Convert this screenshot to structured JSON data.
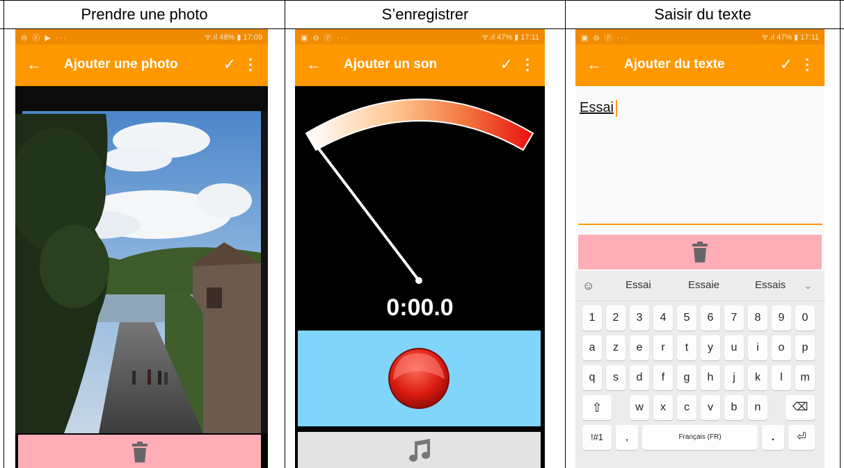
{
  "columns": [
    {
      "title": "Prendre une photo"
    },
    {
      "title": "S’enregistrer"
    },
    {
      "title": "Saisir du texte"
    }
  ],
  "panels": {
    "photo": {
      "status_left": "⊖ ⓟ ▶ ···",
      "status_right": "ᯤ.ıl 48% ▮ 17:09",
      "title": "Ajouter une photo"
    },
    "sound": {
      "status_left": "▣ ⊖ ⓟ ···",
      "status_right": "ᯤ.ıl 47% ▮ 17:11",
      "title": "Ajouter un son",
      "timer": "0:00.0"
    },
    "text": {
      "status_left": "▣ ⊖ ⓟ ···",
      "status_right": "ᯤ.ıl 47% ▮ 17:11",
      "title": "Ajouter du texte",
      "text_value": "Essai",
      "suggestions": [
        "Essai",
        "Essaie",
        "Essais"
      ],
      "row_numbers": [
        "1",
        "2",
        "3",
        "4",
        "5",
        "6",
        "7",
        "8",
        "9",
        "0"
      ],
      "row1": [
        "a",
        "z",
        "e",
        "r",
        "t",
        "y",
        "u",
        "i",
        "o",
        "p"
      ],
      "row2": [
        "q",
        "s",
        "d",
        "f",
        "g",
        "h",
        "j",
        "k",
        "l",
        "m"
      ],
      "row3": [
        "w",
        "x",
        "c",
        "v",
        "b",
        "n"
      ],
      "symbols_key": "!#1",
      "comma_key": ",",
      "space_label": "Français (FR)",
      "period_key": "."
    }
  },
  "icons": {
    "back": "back-arrow-icon",
    "check": "check-icon",
    "more": "more-vert-icon",
    "trash": "trash-icon",
    "record": "record-icon",
    "music": "music-note-icon"
  },
  "colors": {
    "app_bar": "#ff9800",
    "status_bar": "#f08a00",
    "trash_bg": "#ffadb7",
    "record_bg": "#81d4fa"
  }
}
